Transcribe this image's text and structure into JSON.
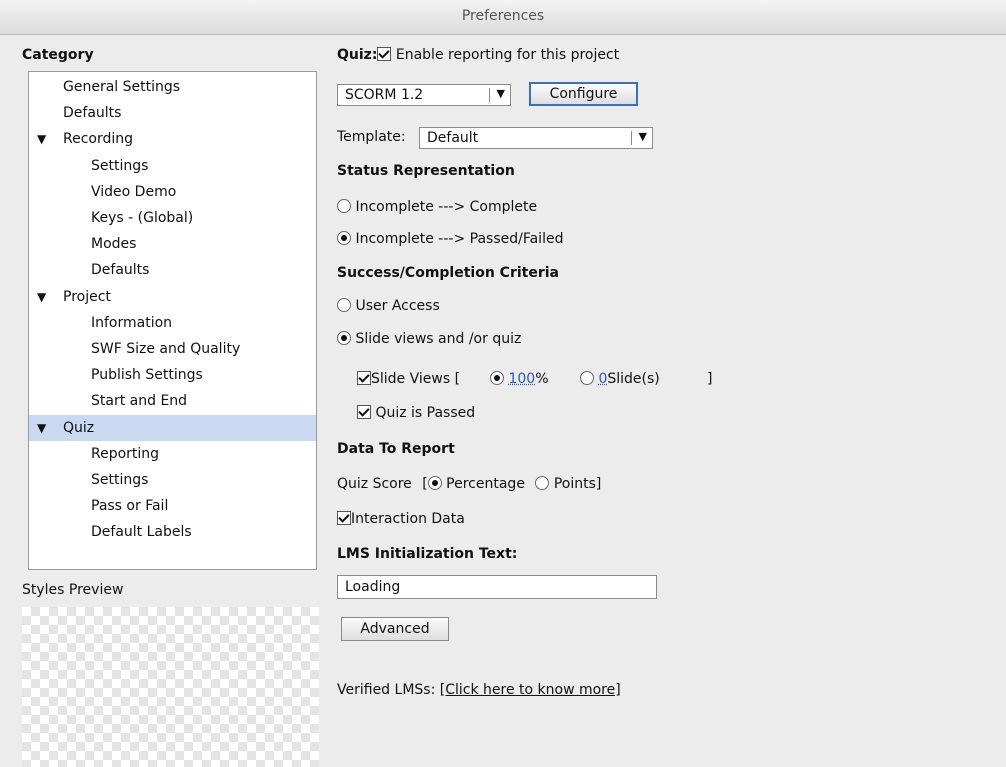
{
  "window": {
    "title": "Preferences"
  },
  "category": {
    "heading": "Category",
    "items": [
      {
        "label": "General Settings",
        "level": 1
      },
      {
        "label": "Defaults",
        "level": 1
      },
      {
        "label": "Recording",
        "level": 1,
        "expanded": true
      },
      {
        "label": "Settings",
        "level": 2
      },
      {
        "label": "Video Demo",
        "level": 2
      },
      {
        "label": "Keys - (Global)",
        "level": 2
      },
      {
        "label": "Modes",
        "level": 2
      },
      {
        "label": "Defaults",
        "level": 2
      },
      {
        "label": "Project",
        "level": 1,
        "expanded": true
      },
      {
        "label": "Information",
        "level": 2
      },
      {
        "label": "SWF Size and Quality",
        "level": 2
      },
      {
        "label": "Publish Settings",
        "level": 2
      },
      {
        "label": "Start and End",
        "level": 2
      },
      {
        "label": "Quiz",
        "level": 1,
        "expanded": true,
        "selected": true
      },
      {
        "label": "Reporting",
        "level": 2
      },
      {
        "label": "Settings",
        "level": 2
      },
      {
        "label": "Pass or Fail",
        "level": 2
      },
      {
        "label": "Default Labels",
        "level": 2
      }
    ],
    "expand_arrow": "▼"
  },
  "styles_preview": {
    "label": "Styles Preview"
  },
  "quiz": {
    "label": "Quiz:",
    "enable_reporting": "Enable reporting for this project",
    "standard_value": "SCORM 1.2",
    "configure_label": "Configure",
    "template_label": "Template:",
    "template_value": "Default"
  },
  "status": {
    "heading": "Status Representation",
    "opt_complete": "Incomplete ---> Complete",
    "opt_passed": "Incomplete ---> Passed/Failed"
  },
  "criteria": {
    "heading": "Success/Completion Criteria",
    "user_access": "User Access",
    "slide_views_quiz": "Slide views and /or quiz",
    "slide_views": "Slide Views [",
    "percent_value": "100",
    "percent_suffix": "%",
    "slides_value": "0",
    "slides_suffix": "Slide(s)",
    "close_bracket": "]",
    "quiz_passed": "Quiz is Passed"
  },
  "data_report": {
    "heading": "Data To Report",
    "quiz_score": "Quiz Score",
    "open_bracket": "[",
    "percentage": "Percentage",
    "points": "Points]",
    "interaction": "Interaction Data"
  },
  "lms": {
    "heading": "LMS Initialization Text:",
    "init_text": "Loading",
    "advanced_label": "Advanced",
    "verified_label": "Verified LMSs:",
    "verified_link": "[Click here to know more]"
  },
  "icons": {
    "dropdown": "▼"
  }
}
